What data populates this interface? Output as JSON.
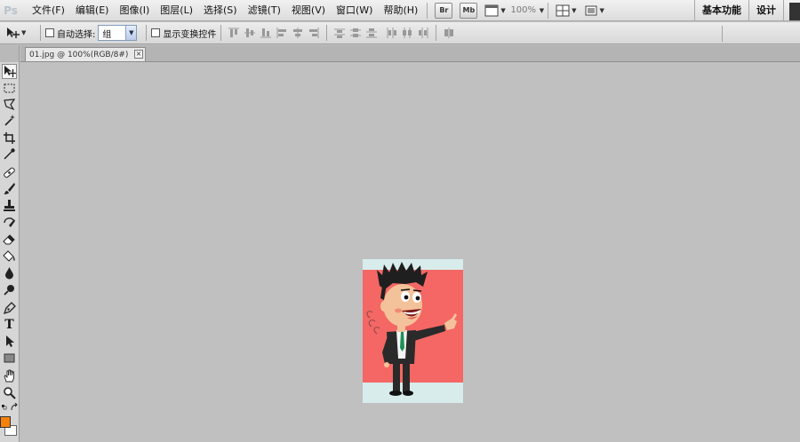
{
  "app": {
    "logo_text": "Ps"
  },
  "menu": {
    "items": [
      "文件(F)",
      "编辑(E)",
      "图像(I)",
      "图层(L)",
      "选择(S)",
      "滤镜(T)",
      "视图(V)",
      "窗口(W)",
      "帮助(H)"
    ],
    "bridge_label": "Br",
    "minibridge_label": "Mb",
    "zoom": "100%"
  },
  "workspace": {
    "basic": "基本功能",
    "design": "设计"
  },
  "options": {
    "auto_select_label": "自动选择:",
    "auto_select_checked": false,
    "auto_select_value": "组",
    "show_transform_label": "显示变换控件",
    "show_transform_checked": false
  },
  "document": {
    "tab_title": "01.jpg @ 100%(RGB/8#)",
    "close_glyph": "×"
  },
  "colors": {
    "foreground": "#f5820b",
    "background": "#ffffff",
    "image_red": "#f46764",
    "image_bg": "#d8ecec"
  },
  "tools": [
    "move-tool",
    "marquee-tool",
    "lasso-tool",
    "quick-select-tool",
    "crop-tool",
    "eyedropper-tool",
    "healing-brush-tool",
    "brush-tool",
    "clone-stamp-tool",
    "history-brush-tool",
    "eraser-tool",
    "paint-bucket-tool",
    "blur-tool",
    "dodge-tool",
    "pen-tool",
    "type-tool",
    "path-select-tool",
    "shape-tool",
    "hand-tool",
    "zoom-tool"
  ],
  "type_tool_glyph": "T"
}
